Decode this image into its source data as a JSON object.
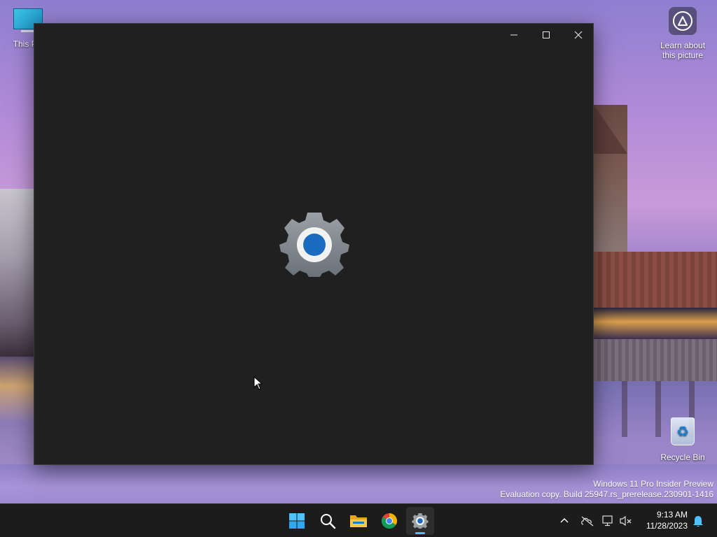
{
  "desktop": {
    "icons": {
      "this_pc": "This PC",
      "learn": [
        "Learn about",
        "this picture"
      ],
      "recycle_bin": "Recycle Bin"
    },
    "watermark": {
      "line1": "Windows 11 Pro Insider Preview",
      "line2": "Evaluation copy. Build 25947.rs_prerelease.230901-1416"
    }
  },
  "window": {
    "app": "Settings",
    "state": "loading-splash",
    "controls": [
      "minimize",
      "maximize",
      "close"
    ],
    "splash_icon": "settings-gear-icon"
  },
  "taskbar": {
    "apps": [
      "start-icon",
      "search-icon",
      "file-explorer-icon",
      "chrome-icon",
      "settings-icon"
    ],
    "active_app": "Settings",
    "tray": {
      "icons": [
        "chevron-up-icon",
        "network-offline-icon",
        "display-icon",
        "volume-muted-icon",
        "notification-bell-icon"
      ],
      "time": "9:13 AM",
      "date": "11/28/2023"
    }
  },
  "colors": {
    "window_bg": "#202020",
    "taskbar_bg": "#1c1c1c",
    "accent": "#4cc2ff",
    "gear_center": "#1a6cc0"
  }
}
